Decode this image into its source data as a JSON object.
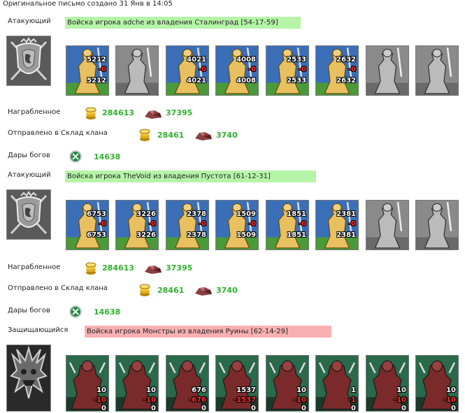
{
  "header": "Оригинальное письмо создано 31 Янв в 14:05",
  "labels": {
    "looted": "Награбленное",
    "sent_to_clan": "Отправлено в Склад клана",
    "gods_gifts": "Дары богов"
  },
  "battles": [
    {
      "role": "Атакующий",
      "title": "Войска игрока adche из владения Сталинград [54-17-59]",
      "units": [
        {
          "icon": "pikeman-icon",
          "n1": "5212",
          "n2": "-0",
          "n3": "5212",
          "color": "#3a6fb8"
        },
        {
          "icon": "grey-pikeman-icon",
          "n1": "",
          "n2": "",
          "n3": "",
          "color": "#888888"
        },
        {
          "icon": "crusader-icon",
          "n1": "4021",
          "n2": "-0",
          "n3": "4021",
          "color": "#3a6fb8"
        },
        {
          "icon": "griffin-icon",
          "n1": "4008",
          "n2": "-0",
          "n3": "4008",
          "color": "#3a6fb8"
        },
        {
          "icon": "crossbowman-icon",
          "n1": "2533",
          "n2": "-0",
          "n3": "2533",
          "color": "#3a6fb8"
        },
        {
          "icon": "monk-icon",
          "n1": "2632",
          "n2": "-0",
          "n3": "2632",
          "color": "#3a6fb8"
        },
        {
          "icon": "grey-cavalier-icon",
          "n1": "",
          "n2": "",
          "n3": "",
          "color": "#888888"
        },
        {
          "icon": "grey-angel-icon",
          "n1": "",
          "n2": "",
          "n3": "",
          "color": "#888888"
        }
      ],
      "looted": {
        "gold": "284613",
        "ore": "37395"
      },
      "sent": {
        "gold": "28461",
        "ore": "3740"
      },
      "gifts": {
        "gem": "14638"
      }
    },
    {
      "role": "Атакующий",
      "title": "Войска игрока TheVoid из владения Пустота [61-12-31]",
      "units": [
        {
          "icon": "pikeman-icon",
          "n1": "6753",
          "n2": "-0",
          "n3": "6753",
          "color": "#3a6fb8"
        },
        {
          "icon": "marksman-icon",
          "n1": "3226",
          "n2": "-0",
          "n3": "3226",
          "color": "#3a6fb8"
        },
        {
          "icon": "crusader-icon",
          "n1": "2378",
          "n2": "-0",
          "n3": "2378",
          "color": "#3a6fb8"
        },
        {
          "icon": "griffin-icon",
          "n1": "1509",
          "n2": "-0",
          "n3": "1509",
          "color": "#3a6fb8"
        },
        {
          "icon": "crossbowman-icon",
          "n1": "1851",
          "n2": "-0",
          "n3": "1851",
          "color": "#3a6fb8"
        },
        {
          "icon": "monk-icon",
          "n1": "2381",
          "n2": "-0",
          "n3": "2381",
          "color": "#3a6fb8"
        },
        {
          "icon": "grey-cavalier-icon",
          "n1": "",
          "n2": "",
          "n3": "",
          "color": "#888888"
        },
        {
          "icon": "grey-angel-icon",
          "n1": "",
          "n2": "",
          "n3": "",
          "color": "#888888"
        }
      ],
      "looted": {
        "gold": "284613",
        "ore": "37395"
      },
      "sent": {
        "gold": "28461",
        "ore": "3740"
      },
      "gifts": {
        "gem": "14638"
      }
    },
    {
      "role": "Защищающийся",
      "title": "Войска игрока Монстры из владения Руины [62-14-29]",
      "units": [
        {
          "icon": "lizard-icon",
          "n1": "10",
          "n2": "-10",
          "n3": "0",
          "color": "#2a6a4a"
        },
        {
          "icon": "golem-icon",
          "n1": "10",
          "n2": "-10",
          "n3": "0",
          "color": "#2a6a4a"
        },
        {
          "icon": "orc-shaman-icon",
          "n1": "676",
          "n2": "-676",
          "n3": "0",
          "color": "#2a6a4a"
        },
        {
          "icon": "imp-icon",
          "n1": "1537",
          "n2": "-1537",
          "n3": "0",
          "color": "#2a6a4a"
        },
        {
          "icon": "spider-icon",
          "n1": "10",
          "n2": "-10",
          "n3": "0",
          "color": "#2a6a4a"
        },
        {
          "icon": "devil-icon",
          "n1": "1",
          "n2": "-1",
          "n3": "0",
          "color": "#2a6a4a"
        },
        {
          "icon": "monolith-icon",
          "n1": "10",
          "n2": "-10",
          "n3": "0",
          "color": "#2a6a4a"
        },
        {
          "icon": "naga-icon",
          "n1": "10",
          "n2": "-10",
          "n3": "0",
          "color": "#2a6a4a"
        }
      ]
    }
  ]
}
